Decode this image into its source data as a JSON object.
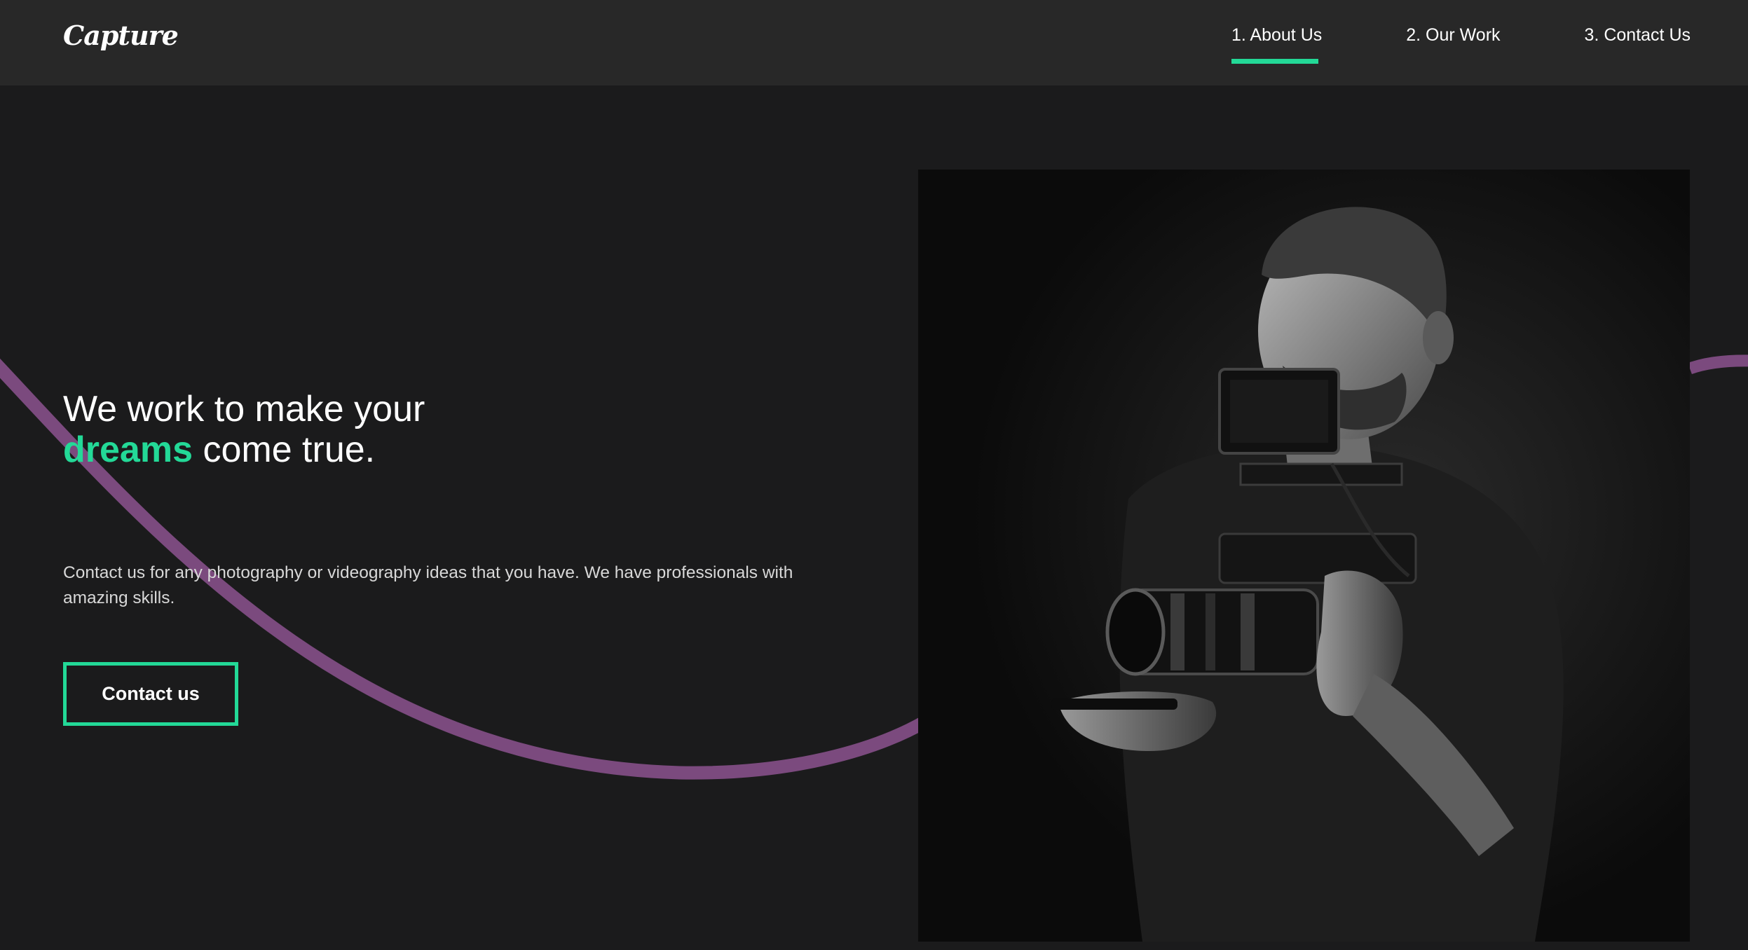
{
  "brand": {
    "logo": "Capture"
  },
  "nav": {
    "items": [
      {
        "label": "1. About Us",
        "active": true
      },
      {
        "label": "2. Our Work",
        "active": false
      },
      {
        "label": "3. Contact Us",
        "active": false
      }
    ]
  },
  "hero": {
    "title_part1": "We work to make your",
    "title_accent": "dreams",
    "title_part2": "come true.",
    "description": "Contact us for any photography or videography ideas that you have. We have professionals with amazing skills.",
    "cta_label": "Contact us",
    "image_icon": "photographer-with-camera-image"
  },
  "colors": {
    "background": "#1b1b1c",
    "header": "#282828",
    "accent": "#23d997",
    "wave": "#7b4a7e",
    "text": "#ffffff"
  }
}
